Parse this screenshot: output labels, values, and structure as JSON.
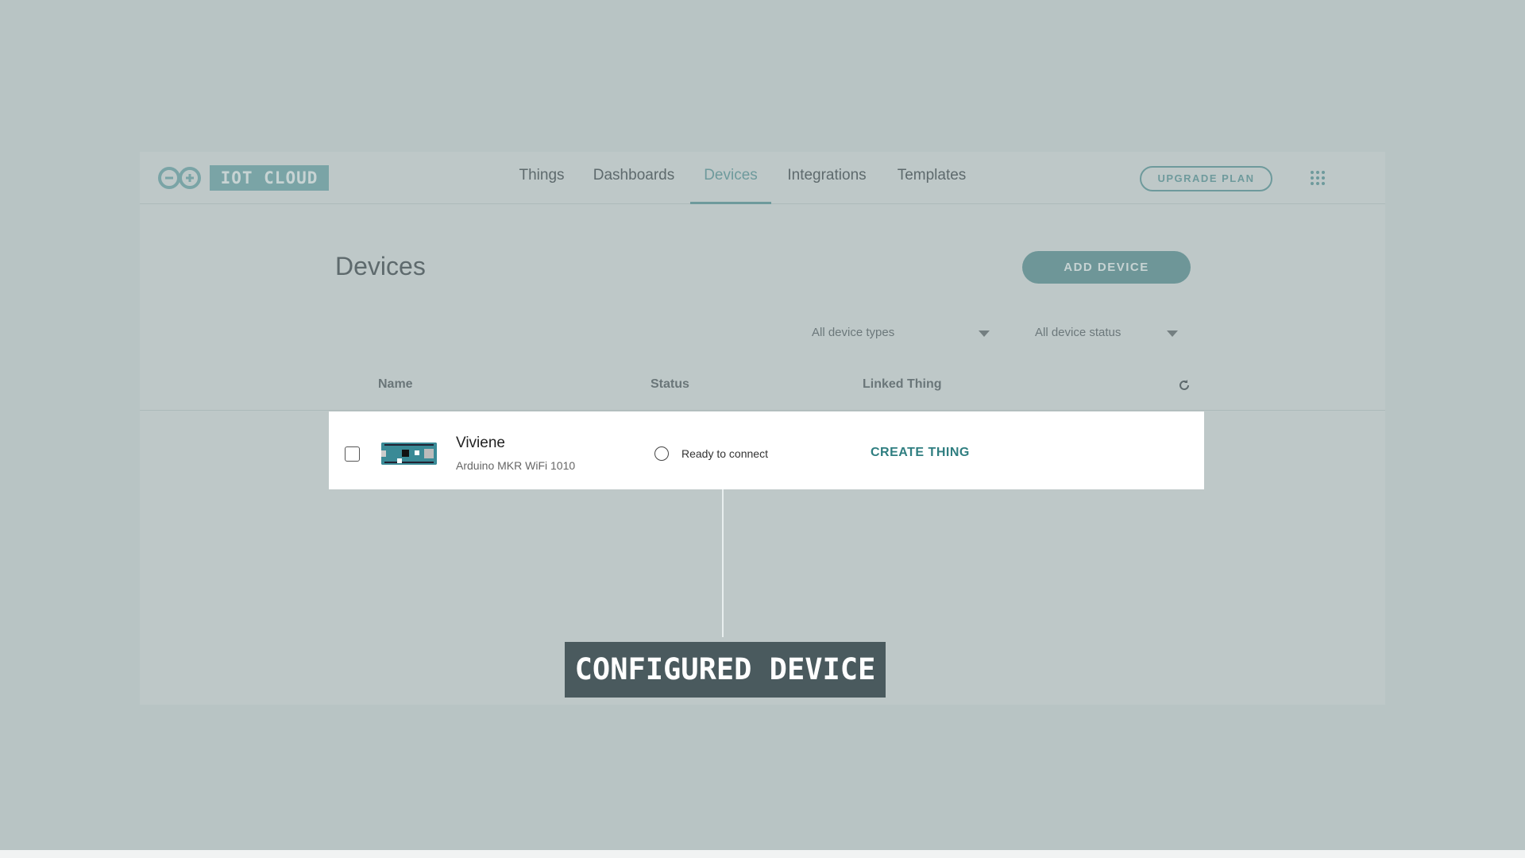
{
  "header": {
    "logo_text": "IOT CLOUD",
    "nav": [
      {
        "label": "Things"
      },
      {
        "label": "Dashboards"
      },
      {
        "label": "Devices",
        "active": true
      },
      {
        "label": "Integrations"
      },
      {
        "label": "Templates"
      }
    ],
    "upgrade_label": "UPGRADE PLAN",
    "apps_icon": "grid-icon"
  },
  "page": {
    "title": "Devices",
    "add_label": "ADD DEVICE",
    "filters": {
      "types": "All device types",
      "status": "All device status"
    }
  },
  "table": {
    "columns": [
      "Name",
      "Status",
      "Linked Thing"
    ],
    "refresh_icon": "refresh-icon",
    "rows": [
      {
        "name": "Viviene",
        "type": "Arduino MKR WiFi 1010",
        "status": "Ready to connect",
        "linked": "CREATE THING"
      }
    ]
  },
  "annotation": "CONFIGURED DEVICE",
  "colors": {
    "accent": "#6e9a9c",
    "link": "#2f7e80",
    "overlay": "#b8c4c4"
  }
}
